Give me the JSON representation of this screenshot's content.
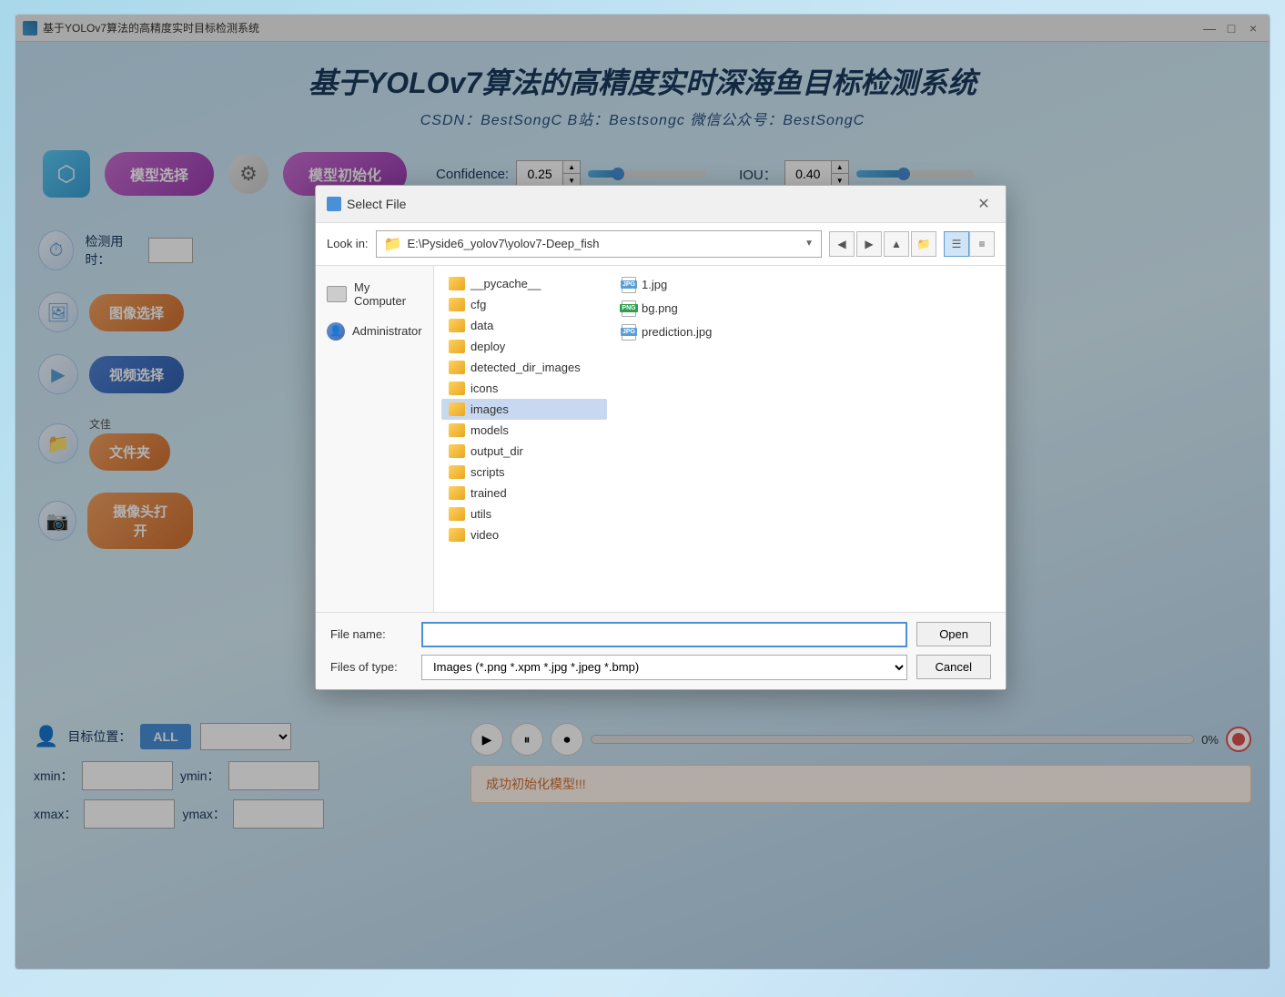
{
  "window": {
    "title": "基于YOLOv7算法的高精度实时目标检测系统",
    "minimize": "—",
    "maximize": "□",
    "close": "×"
  },
  "header": {
    "title": "基于YOLOv7算法的高精度实时深海鱼目标检测系统",
    "subtitle": "CSDN：BestSongC    B站：Bestsongc    微信公众号：BestSongC"
  },
  "toolbar": {
    "model_select_label": "模型选择",
    "model_init_label": "模型初始化",
    "confidence_label": "Confidence:",
    "confidence_value": "0.25",
    "iou_label": "IOU：",
    "iou_value": "0.40",
    "confidence_pct": 25,
    "iou_pct": 40
  },
  "sidebar": {
    "detect_time_label": "检测用时：",
    "image_select_label": "图像选择",
    "video_select_label": "视频选择",
    "folder_label": "文件夹",
    "folder_note": "文佳",
    "camera_label": "摄像头打开"
  },
  "bottom": {
    "target_label": "目标位置：",
    "all_label": "ALL",
    "xmin_label": "xmin：",
    "ymin_label": "ymin：",
    "xmax_label": "xmax：",
    "ymax_label": "ymax：",
    "progress_pct": "0%",
    "status_text": "成功初始化模型!!!"
  },
  "dialog": {
    "title": "Select File",
    "lookin_label": "Look in:",
    "lookin_path": "E:\\Pyside6_yolov7\\yolov7-Deep_fish",
    "filename_label": "File name:",
    "filetype_label": "Files of type:",
    "filetype_value": "Images (*.png *.xpm *.jpg *.jpeg *.bmp)",
    "open_btn": "Open",
    "cancel_btn": "Cancel",
    "sidebar_items": [
      {
        "label": "My Computer",
        "type": "computer"
      },
      {
        "label": "Administrator",
        "type": "admin"
      }
    ],
    "folders": [
      {
        "name": "__pycache__",
        "type": "folder"
      },
      {
        "name": "cfg",
        "type": "folder"
      },
      {
        "name": "data",
        "type": "folder"
      },
      {
        "name": "deploy",
        "type": "folder"
      },
      {
        "name": "detected_dir_images",
        "type": "folder"
      },
      {
        "name": "icons",
        "type": "folder"
      },
      {
        "name": "images",
        "type": "folder",
        "selected": true
      },
      {
        "name": "models",
        "type": "folder"
      },
      {
        "name": "output_dir",
        "type": "folder"
      },
      {
        "name": "scripts",
        "type": "folder"
      },
      {
        "name": "trained",
        "type": "folder"
      },
      {
        "name": "utils",
        "type": "folder"
      },
      {
        "name": "video",
        "type": "folder"
      }
    ],
    "files": [
      {
        "name": "1.jpg",
        "type": "jpg"
      },
      {
        "name": "bg.png",
        "type": "png"
      },
      {
        "name": "prediction.jpg",
        "type": "jpg"
      }
    ]
  }
}
